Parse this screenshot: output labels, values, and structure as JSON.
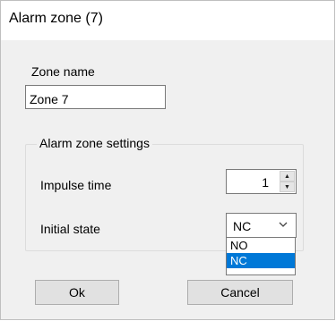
{
  "window": {
    "title": "Alarm zone (7)"
  },
  "zone_name": {
    "label": "Zone name",
    "value": "Zone 7"
  },
  "settings": {
    "group_title": "Alarm zone settings",
    "impulse_time": {
      "label": "Impulse time",
      "value": "1"
    },
    "initial_state": {
      "label": "Initial state",
      "value": "NC",
      "options": [
        "NO",
        "NC"
      ],
      "highlighted": "NC"
    }
  },
  "buttons": {
    "ok": "Ok",
    "cancel": "Cancel"
  },
  "colors": {
    "selection": "#0078d7",
    "dialog_bg": "#f0f0f0"
  },
  "icons": {
    "spin_up": "up-arrow-icon",
    "spin_down": "down-arrow-icon",
    "dropdown": "chevron-down-icon"
  }
}
